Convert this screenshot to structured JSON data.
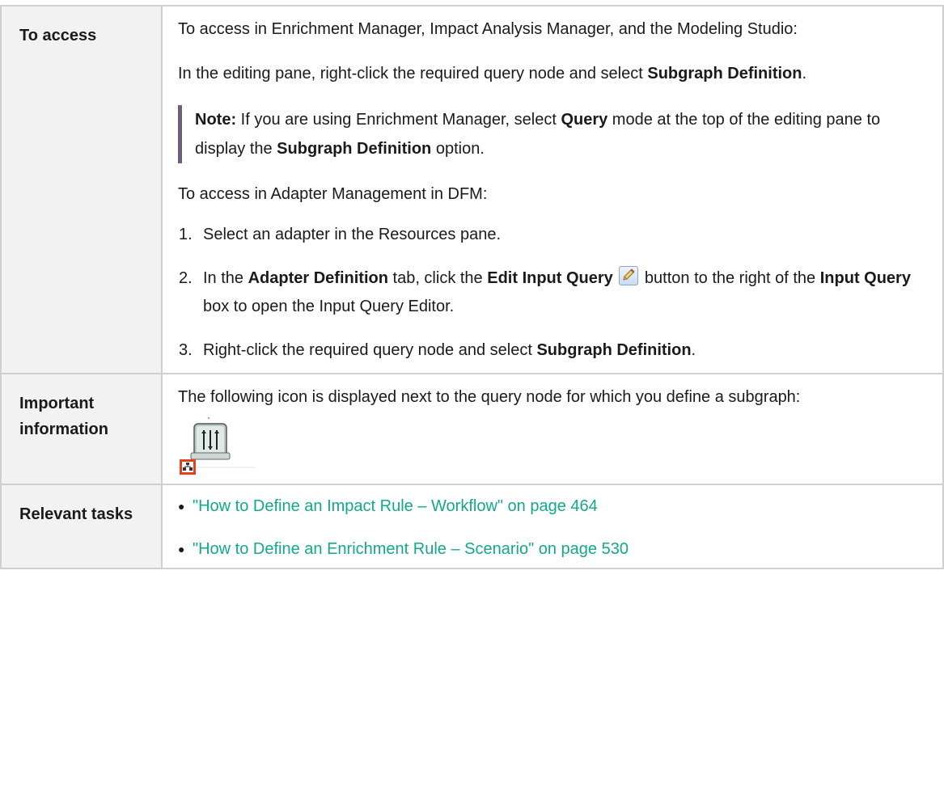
{
  "rows": {
    "access": {
      "heading": "To access",
      "intro_1": "To access in Enrichment Manager, Impact Analysis Manager, and the Modeling Studio:",
      "intro_2_pre": "In the editing pane, right-click the required query node and select ",
      "intro_2_bold": "Subgraph Definition",
      "intro_2_post": ".",
      "note": {
        "label": "Note:",
        "text_1": " If you are using Enrichment Manager, select ",
        "bold_1": "Query",
        "text_2": " mode at the top of the editing pane to display the ",
        "bold_2": "Subgraph Definition",
        "text_3": " option."
      },
      "dfm_intro": "To access in Adapter Management in DFM:",
      "steps": [
        {
          "num": "1.",
          "text": "Select an adapter in the Resources pane."
        },
        {
          "num": "2.",
          "pre": "In the ",
          "b1": "Adapter Definition",
          "mid1": " tab, click the ",
          "b2": "Edit Input Query",
          "mid2": " button to the right of the ",
          "b3": "Input Query",
          "post": " box to open the Input Query Editor."
        },
        {
          "num": "3.",
          "pre": "Right-click the required query node and select ",
          "b1": "Subgraph Definition",
          "post": "."
        }
      ],
      "icon": "pencil-edit-icon"
    },
    "important": {
      "heading": "Important information",
      "text": "The following icon is displayed next to the query node for which you define a subgraph:",
      "icon": "query-node-subgraph-icon"
    },
    "tasks": {
      "heading": "Relevant tasks",
      "links": [
        "\"How to Define an Impact Rule – Workflow\" on page 464",
        "\"How to Define an Enrichment Rule – Scenario\" on page 530"
      ]
    }
  },
  "colors": {
    "link": "#13a88a",
    "note_bar": "#6e5f78",
    "header_bg": "#f2f2f2",
    "border": "#cfcfcf",
    "badge": "#e8401c"
  }
}
